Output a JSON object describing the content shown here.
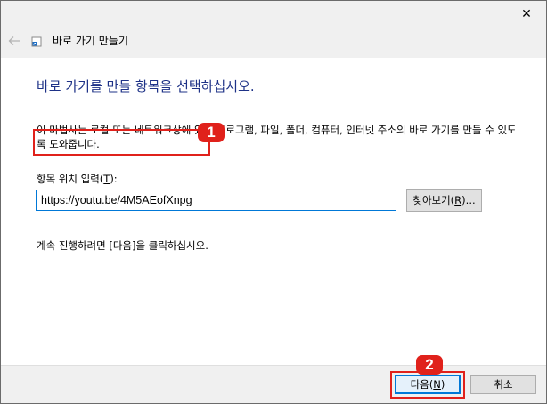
{
  "window": {
    "title": "바로 가기 만들기",
    "close_glyph": "✕"
  },
  "page": {
    "heading": "바로 가기를 만들 항목을 선택하십시오.",
    "description": "이 마법사는 로컬 또는 네트워크상에 있는 프로그램, 파일, 폴더, 컴퓨터, 인터넷 주소의 바로 가기를 만들 수 있도록 도와줍니다.",
    "location_label_prefix": "항목 위치 입력(",
    "location_label_key": "T",
    "location_label_suffix": "):",
    "location_value": "https://youtu.be/4M5AEofXnpg",
    "browse_prefix": "찾아보기(",
    "browse_key": "R",
    "browse_suffix": ")...",
    "continue_hint": "계속 진행하려면 [다음]을 클릭하십시오."
  },
  "footer": {
    "next_prefix": "다음(",
    "next_key": "N",
    "next_suffix": ")",
    "cancel_label": "취소"
  },
  "annotations": {
    "marker1": "1",
    "marker2": "2"
  },
  "colors": {
    "heading": "#1e3287",
    "marker": "#e0211b",
    "focus_border": "#0078d7"
  },
  "icons": {
    "back": "back-arrow-icon",
    "wizard": "shortcut-icon",
    "close": "close-icon"
  }
}
